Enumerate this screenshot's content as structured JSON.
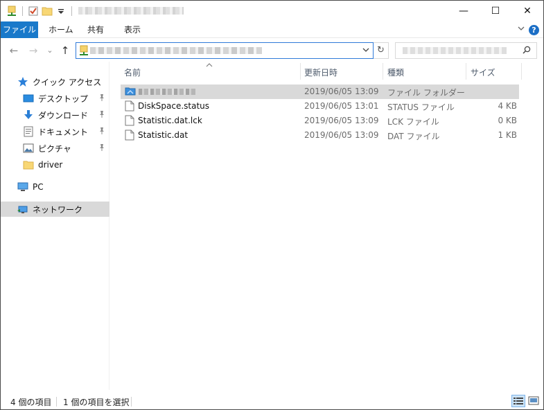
{
  "ribbon": {
    "tabs": [
      "ファイル",
      "ホーム",
      "共有",
      "表示"
    ]
  },
  "window_controls": {
    "minimize": "—",
    "maximize": "☐",
    "close": "✕"
  },
  "navbar": {
    "back": "←",
    "forward": "→",
    "recent": "⌄",
    "up": "↑",
    "refresh": "↻",
    "dropdown": "⌄"
  },
  "help": "?",
  "navpane": {
    "quick_access": "クイック アクセス",
    "items": [
      {
        "label": "デスクトップ",
        "icon": "desktop-icon",
        "pinned": true
      },
      {
        "label": "ダウンロード",
        "icon": "download-icon",
        "pinned": true
      },
      {
        "label": "ドキュメント",
        "icon": "document-icon",
        "pinned": true
      },
      {
        "label": "ピクチャ",
        "icon": "pictures-icon",
        "pinned": true
      },
      {
        "label": "driver",
        "icon": "folder-icon",
        "pinned": false
      }
    ],
    "pc": "PC",
    "network": "ネットワーク"
  },
  "columns": {
    "name": "名前",
    "date": "更新日時",
    "type": "種類",
    "size": "サイズ"
  },
  "files": [
    {
      "name": "",
      "date": "2019/06/05 13:09",
      "type": "ファイル フォルダー",
      "size": "",
      "icon": "network-folder-icon",
      "selected": true
    },
    {
      "name": "DiskSpace.status",
      "date": "2019/06/05 13:01",
      "type": "STATUS ファイル",
      "size": "4 KB",
      "icon": "file-icon",
      "selected": false
    },
    {
      "name": "Statistic.dat.lck",
      "date": "2019/06/05 13:09",
      "type": "LCK ファイル",
      "size": "0 KB",
      "icon": "file-icon",
      "selected": false
    },
    {
      "name": "Statistic.dat",
      "date": "2019/06/05 13:09",
      "type": "DAT ファイル",
      "size": "1 KB",
      "icon": "file-icon",
      "selected": false
    }
  ],
  "status": {
    "count": "4 個の項目",
    "selected": "1 個の項目を選択"
  },
  "colors": {
    "file_tab": "#1979ca",
    "address_border": "#2f7ad9",
    "selection": "#d9d9d9",
    "column_header": "#4d5a6b"
  }
}
